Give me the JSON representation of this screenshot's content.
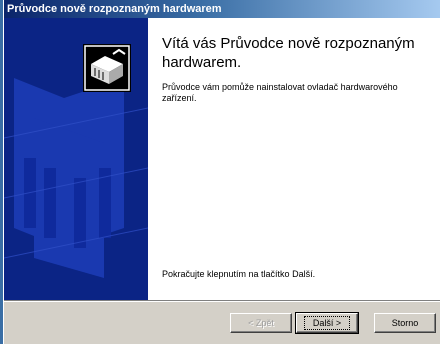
{
  "window": {
    "title": "Průvodce nově rozpoznaným hardwarem"
  },
  "content": {
    "heading": "Vítá vás Průvodce nově rozpoznaným hardwarem.",
    "description": "Průvodce vám pomůže nainstalovat ovladač hardwarového zařízení.",
    "instruction": "Pokračujte klepnutím na tlačítko Další."
  },
  "buttons": {
    "back": "< Zpět",
    "next": "Další >",
    "cancel": "Storno"
  },
  "icons": {
    "banner": "hardware-wizard-icon"
  },
  "colors": {
    "banner": "#0b2485",
    "titlebar_start": "#0a246a",
    "face": "#d4d0c8"
  }
}
